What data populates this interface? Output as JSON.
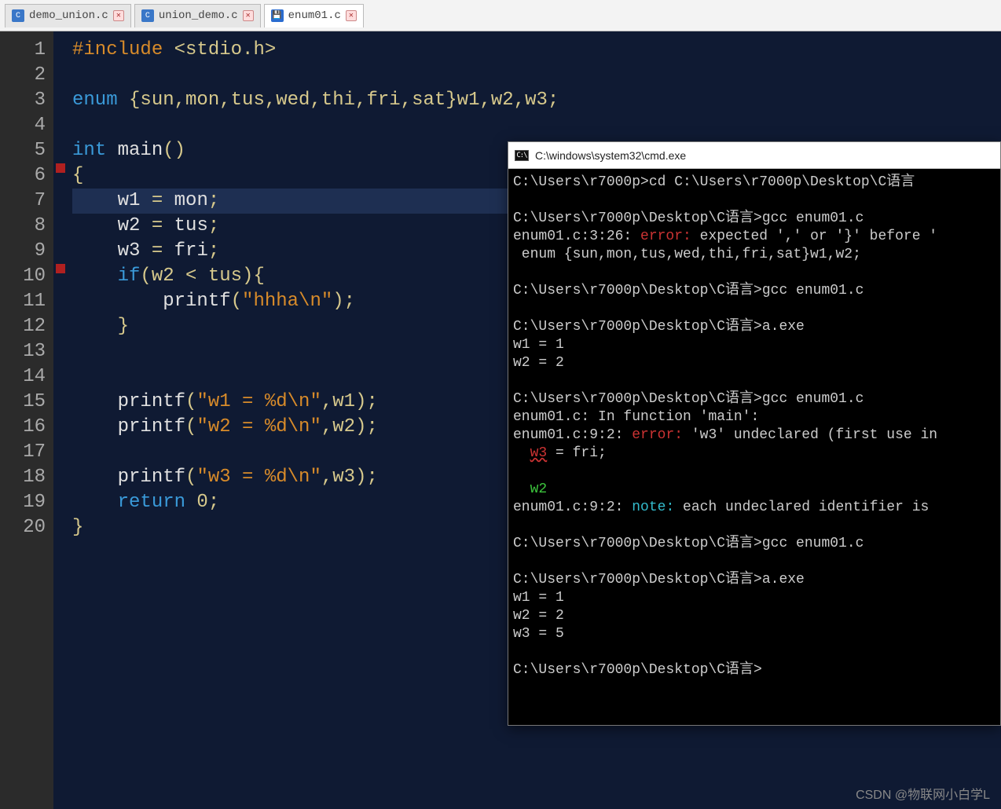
{
  "tabs": [
    {
      "label": "demo_union.c",
      "active": false
    },
    {
      "label": "union_demo.c",
      "active": false
    },
    {
      "label": "enum01.c",
      "active": true
    }
  ],
  "gutter": {
    "start": 1,
    "end": 20
  },
  "fold_rows": [
    6,
    10
  ],
  "highlight_row": 7,
  "code": {
    "l1": {
      "pp": "#include ",
      "inc": "<stdio.h>"
    },
    "l2": "",
    "l3": {
      "kw": "enum",
      "rest": " {sun,mon,tus,wed,thi,fri,sat}w1,w2,w3;"
    },
    "l4": "",
    "l5": {
      "kw": "int",
      "fn": " main",
      "paren": "()"
    },
    "l6": "{",
    "l7": {
      "indent": "    ",
      "id": "w1",
      "op": " = ",
      "val": "mon",
      "semi": ";"
    },
    "l8": {
      "indent": "    ",
      "id": "w2",
      "op": " = ",
      "val": "tus",
      "semi": ";"
    },
    "l9": {
      "indent": "    ",
      "id": "w3",
      "op": " = ",
      "val": "fri",
      "semi": ";"
    },
    "l10": {
      "indent": "    ",
      "kw": "if",
      "cond": "(w2 < tus){"
    },
    "l11": {
      "indent": "        ",
      "fn": "printf",
      "open": "(",
      "str": "\"hhha\\n\"",
      "close": ");"
    },
    "l12": {
      "indent": "    ",
      "brace": "}"
    },
    "l13": "",
    "l14": "",
    "l15": {
      "indent": "    ",
      "fn": "printf",
      "open": "(",
      "str": "\"w1 = %d\\n\"",
      "args": ",w1",
      "close": ");"
    },
    "l16": {
      "indent": "    ",
      "fn": "printf",
      "open": "(",
      "str": "\"w2 = %d\\n\"",
      "args": ",w2",
      "close": ");"
    },
    "l17": "",
    "l18": {
      "indent": "    ",
      "fn": "printf",
      "open": "(",
      "str": "\"w3 = %d\\n\"",
      "args": ",w3",
      "close": ");"
    },
    "l19": {
      "indent": "    ",
      "kw": "return",
      "rest": " 0;"
    },
    "l20": "}"
  },
  "cmd": {
    "title": "C:\\windows\\system32\\cmd.exe",
    "lines": [
      {
        "t": "C:\\Users\\r7000p>cd C:\\Users\\r7000p\\Desktop\\C语言"
      },
      {
        "t": ""
      },
      {
        "t": "C:\\Users\\r7000p\\Desktop\\C语言>gcc enum01.c"
      },
      {
        "pre": "enum01.c:3:26: ",
        "err": "error:",
        "post": " expected ',' or '}' before '"
      },
      {
        "t": " enum {sun,mon,tus,wed,thi,fri,sat}w1,w2;",
        "caret": 28
      },
      {
        "t": ""
      },
      {
        "t": "C:\\Users\\r7000p\\Desktop\\C语言>gcc enum01.c"
      },
      {
        "t": ""
      },
      {
        "t": "C:\\Users\\r7000p\\Desktop\\C语言>a.exe"
      },
      {
        "t": "w1 = 1"
      },
      {
        "t": "w2 = 2"
      },
      {
        "t": ""
      },
      {
        "t": "C:\\Users\\r7000p\\Desktop\\C语言>gcc enum01.c"
      },
      {
        "t": "enum01.c: In function 'main':"
      },
      {
        "pre": "enum01.c:9:2: ",
        "err": "error:",
        "post": " 'w3' undeclared (first use in"
      },
      {
        "t": "  ",
        "und": "w3",
        "post2": " = fri;"
      },
      {
        "t": ""
      },
      {
        "t": "  ",
        "grn": "w2"
      },
      {
        "pre": "enum01.c:9:2: ",
        "note": "note:",
        "post": " each undeclared identifier is "
      },
      {
        "t": ""
      },
      {
        "t": "C:\\Users\\r7000p\\Desktop\\C语言>gcc enum01.c"
      },
      {
        "t": ""
      },
      {
        "t": "C:\\Users\\r7000p\\Desktop\\C语言>a.exe"
      },
      {
        "t": "w1 = 1"
      },
      {
        "t": "w2 = 2"
      },
      {
        "t": "w3 = 5"
      },
      {
        "t": ""
      },
      {
        "t": "C:\\Users\\r7000p\\Desktop\\C语言>"
      }
    ]
  },
  "watermark": "CSDN @物联网小白学L"
}
